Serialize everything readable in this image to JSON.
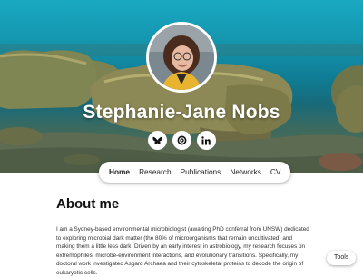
{
  "profile": {
    "name": "Stephanie-Jane Nobs",
    "avatar_alt": "Profile photo"
  },
  "socials": [
    {
      "icon": "bluesky-icon",
      "label": "Bluesky"
    },
    {
      "icon": "orcid-icon",
      "label": "ORCID"
    },
    {
      "icon": "linkedin-icon",
      "label": "LinkedIn"
    }
  ],
  "nav": {
    "items": [
      "Home",
      "Research",
      "Publications",
      "Networks",
      "CV"
    ],
    "active": "Home"
  },
  "about": {
    "heading": "About me",
    "text": "I am a Sydney-based environmental microbiologist (awaiting PhD conferral from UNSW) dedicated to exploring microbial dark matter (the 80% of microorganisms that remain uncultivated) and making them a little less dark. Driven by an early interest in astrobiology, my research focuses on extremophiles, microbe-environment interactions, and evolutionary transitions. Specifically, my doctoral work investigated Asgard Archaea and their cytoskeletal proteins to decode the origin of eukaryotic cells."
  },
  "tools": {
    "label": "Tools"
  },
  "colors": {
    "water_top": "#1aa9c2",
    "stromatolite": "#8a8a5a",
    "avatar_jacket": "#e8b430",
    "text": "#333333"
  }
}
